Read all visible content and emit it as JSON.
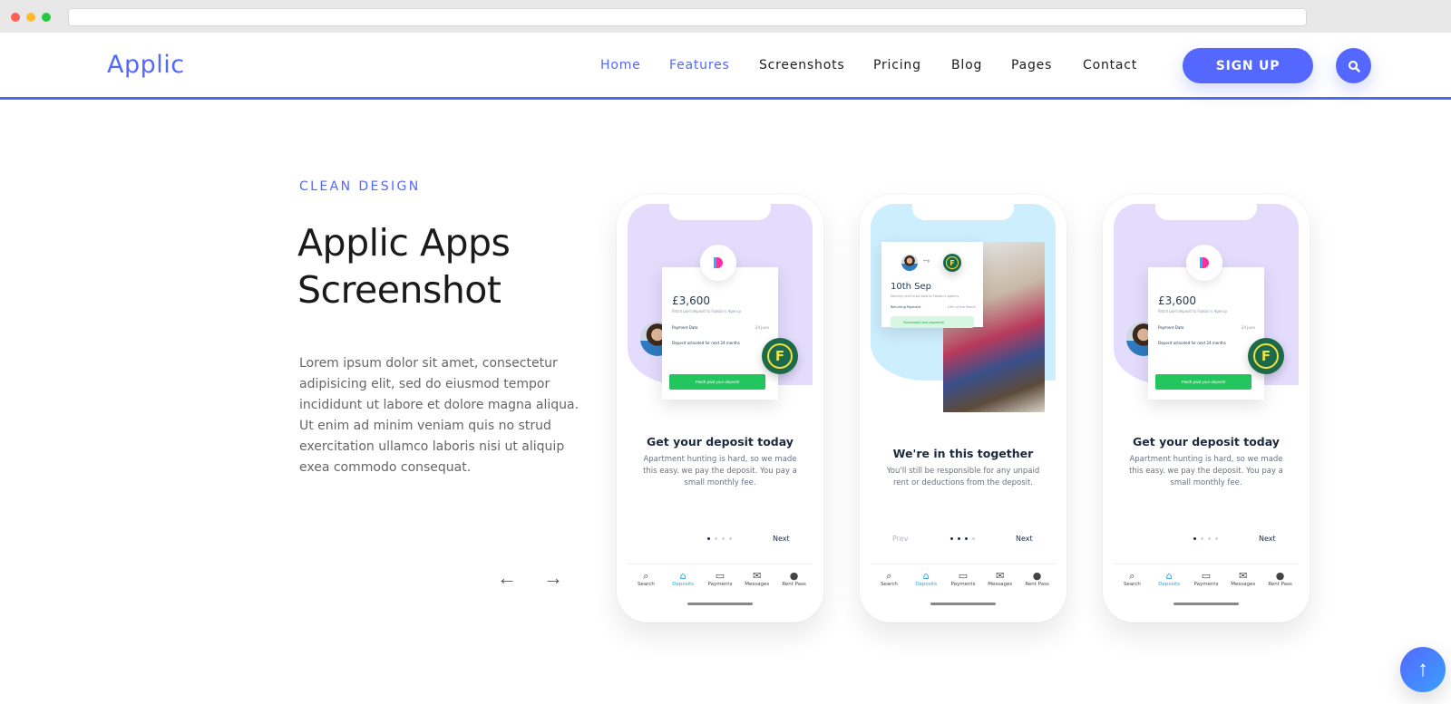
{
  "browser": {
    "url": ""
  },
  "nav": {
    "logo": "Applic",
    "items": [
      {
        "label": "Home",
        "active": true
      },
      {
        "label": "Features",
        "active": true
      },
      {
        "label": "Screenshots",
        "active": false
      },
      {
        "label": "Pricing",
        "active": false
      },
      {
        "label": "Blog",
        "active": false
      },
      {
        "label": "Pages",
        "active": false
      },
      {
        "label": "Contact",
        "active": false
      }
    ],
    "signup_label": "SIGN UP",
    "search_icon": "search-icon",
    "accent_color": "#5468ff"
  },
  "section": {
    "eyebrow": "CLEAN DESIGN",
    "title_line1": "Applic Apps",
    "title_line2": "Screenshot",
    "description": "Lorem ipsum dolor sit amet, consectetur adipisicing elit, sed do eiusmod tempor incididunt ut labore et dolore magna aliqua. Ut enim ad minim veniam quis no strud exercitation ullamco laboris nisi ut aliquip exea commodo consequat.",
    "prev_arrow": "←",
    "next_arrow": "→"
  },
  "phones": [
    {
      "amount": "£3,600",
      "amount_sub": "Patch paid deposit to Foxton's Agency",
      "row1_label": "Payment Date",
      "row1_value": "24 June",
      "row2_label": "Deposit activated for next 24 months",
      "cta": "Patch paid your deposit!",
      "heading": "Get your deposit today",
      "text": "Apartment hunting is hard, so we made this easy. we pay the deposit. You pay a small monthly fee.",
      "next": "Next",
      "active_dot": 1
    },
    {
      "date": "10th Sep",
      "date_sub": "Monthly rent to be paid to Foxton's Agency",
      "row1_label": "Recurring Payment",
      "row1_value": "10th of the Month",
      "status": "Successful rent payment!",
      "heading": "We're in this together",
      "text": "You'll still be responsible for any unpaid rent or deductions from the deposit.",
      "prev": "Prev",
      "next": "Next",
      "active_dot": 3
    },
    {
      "amount": "£3,600",
      "amount_sub": "Patch paid deposit to Foxton's Agency",
      "row1_label": "Payment Date",
      "row1_value": "24 June",
      "row2_label": "Deposit activated for next 24 months",
      "cta": "Patch paid your deposit!",
      "heading": "Get your deposit today",
      "text": "Apartment hunting is hard, so we made this easy. we pay the deposit. You pay a small monthly fee.",
      "next": "Next",
      "active_dot": 1
    }
  ],
  "tabbar": [
    {
      "label": "Search",
      "icon": "search-icon",
      "active": false
    },
    {
      "label": "Deposits",
      "icon": "home-icon",
      "active": true
    },
    {
      "label": "Payments",
      "icon": "payment-icon",
      "active": false
    },
    {
      "label": "Messages",
      "icon": "mail-icon",
      "active": false
    },
    {
      "label": "Rent Pass",
      "icon": "avatar-icon",
      "active": false
    }
  ],
  "back_to_top": "↑"
}
